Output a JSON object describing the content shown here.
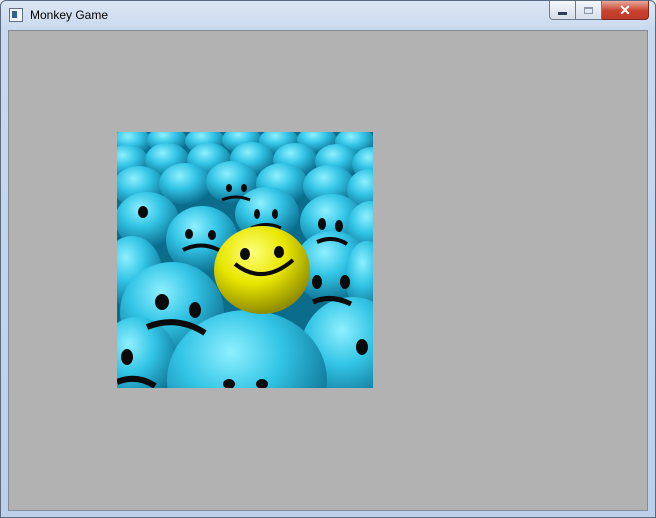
{
  "window": {
    "title": "Monkey Game",
    "buttons": {
      "minimize": "minimize",
      "maximize": "maximize",
      "close": "✕"
    }
  },
  "client": {
    "background": "#b2b2b2"
  },
  "image": {
    "description_icon": "smiley-balls-image",
    "colors": {
      "crowd": "#2fb6d9",
      "highlight": "#e6e600"
    }
  }
}
